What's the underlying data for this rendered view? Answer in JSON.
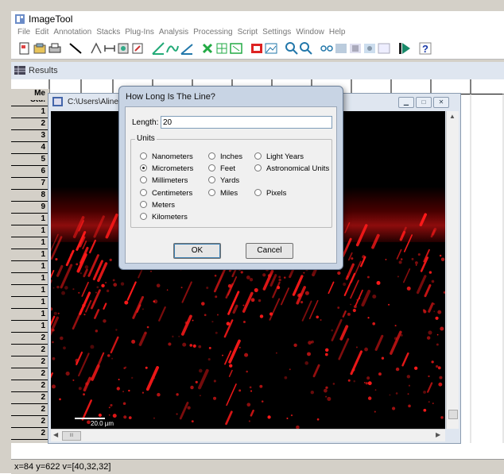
{
  "app": {
    "title": "ImageTool",
    "menu": [
      "File",
      "Edit",
      "Annotation",
      "Stacks",
      "Plug-Ins",
      "Analysis",
      "Processing",
      "Script",
      "Settings",
      "Window",
      "Help"
    ],
    "toolbar_icons": [
      "new-icon",
      "open-icon",
      "print-icon",
      "line-tool-icon",
      "tool-a-icon",
      "tool-b-icon",
      "tool-c-icon",
      "tool-d-icon",
      "angle-icon",
      "curve-icon",
      "measure-icon",
      "grid-icon",
      "cross-icon",
      "rectangle-icon",
      "roi-icon",
      "zoom-in-icon",
      "zoom-out-icon",
      "link-icon",
      "image-a-icon",
      "image-b-icon",
      "image-c-icon",
      "image-d-icon",
      "play-icon",
      "help-icon"
    ]
  },
  "results": {
    "title": "Results",
    "header_label": "Me",
    "row_labels": [
      "Std.",
      "1",
      "2",
      "3",
      "4",
      "5",
      "6",
      "7",
      "8",
      "9",
      "1",
      "1",
      "1",
      "1",
      "1",
      "1",
      "1",
      "1",
      "1",
      "1",
      "2",
      "2",
      "2",
      "2",
      "2",
      "2",
      "2",
      "2",
      "2"
    ]
  },
  "image_window": {
    "title": "C:\\Users\\Aline\\D",
    "scale_label": "20.0 µm",
    "hscroll_thumb": "III"
  },
  "dialog": {
    "title": "How Long Is The Line?",
    "length_label": "Length:",
    "length_value": "20",
    "units_label": "Units",
    "units_col1": [
      "Nanometers",
      "Micrometers",
      "Millimeters",
      "Centimeters",
      "Meters",
      "Kilometers"
    ],
    "units_col2": [
      "Inches",
      "Feet",
      "Yards",
      "Miles"
    ],
    "units_col3": [
      "Light Years",
      "Astronomical Units",
      "",
      "Pixels"
    ],
    "selected_unit": "Micrometers",
    "ok_label": "OK",
    "cancel_label": "Cancel"
  },
  "status": {
    "text": "x=84 y=622 v=[40,32,32]"
  },
  "colors": {
    "fluorescence": "#ff1a1a",
    "background": "#000000",
    "dialog_frame": "#c8d4e4"
  }
}
